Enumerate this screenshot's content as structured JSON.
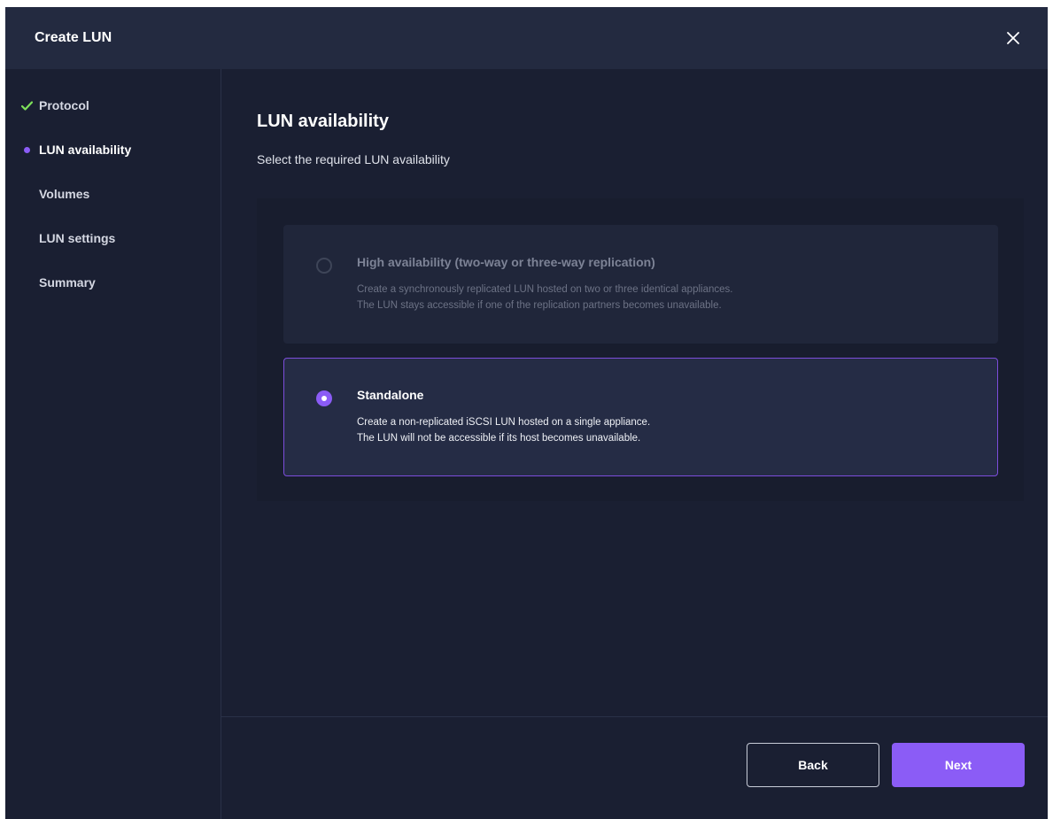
{
  "dialog": {
    "title": "Create LUN",
    "close_icon": "close-icon"
  },
  "sidebar": {
    "steps": [
      {
        "label": "Protocol",
        "state": "completed",
        "icon": "check-icon"
      },
      {
        "label": "LUN availability",
        "state": "active",
        "icon": "dot-icon"
      },
      {
        "label": "Volumes",
        "state": "pending"
      },
      {
        "label": "LUN settings",
        "state": "pending"
      },
      {
        "label": "Summary",
        "state": "pending"
      }
    ]
  },
  "main": {
    "heading": "LUN availability",
    "subheading": "Select the required LUN availability",
    "options": [
      {
        "title": "High availability (two-way or three-way replication)",
        "desc_line1": "Create a synchronously replicated LUN hosted on two or three identical appliances.",
        "desc_line2": "The LUN stays accessible if one of the replication partners becomes unavailable.",
        "selected": false,
        "disabled": true
      },
      {
        "title": "Standalone",
        "desc_line1": "Create a non-replicated iSCSI LUN hosted on a single appliance.",
        "desc_line2": "The LUN will not be accessible if its host becomes unavailable.",
        "selected": true,
        "disabled": false
      }
    ]
  },
  "footer": {
    "back_label": "Back",
    "next_label": "Next"
  },
  "colors": {
    "accent": "#8b5cf6",
    "check": "#7ee05a",
    "background": "#1a1f32",
    "header": "#232a40"
  }
}
